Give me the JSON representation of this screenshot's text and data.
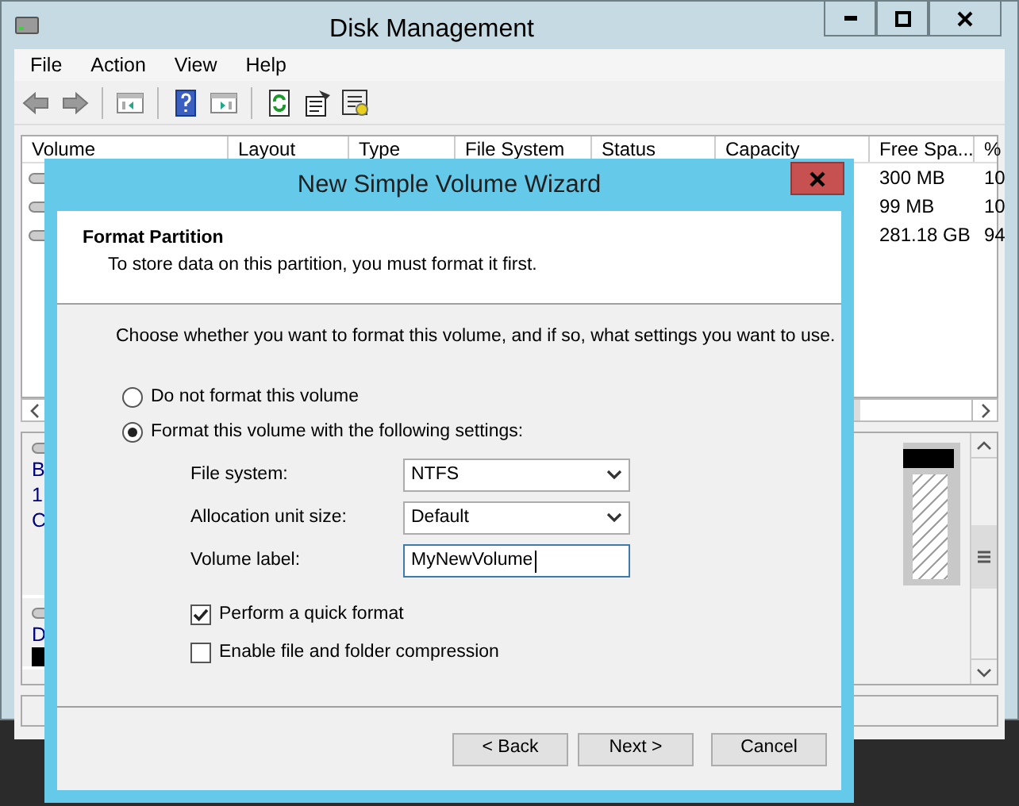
{
  "window": {
    "title": "Disk Management"
  },
  "menu": [
    "File",
    "Action",
    "View",
    "Help"
  ],
  "table": {
    "columns": [
      "Volume",
      "Layout",
      "Type",
      "File System",
      "Status",
      "Capacity",
      "Free Spa...",
      "%"
    ],
    "rows": [
      {
        "free_space": "300 MB",
        "column_8": "10"
      },
      {
        "free_space": "99 MB",
        "column_8": "10"
      },
      {
        "free_space": "281.18 GB",
        "column_8": "94"
      }
    ]
  },
  "disks": [
    {
      "lines": [
        "B",
        "1",
        "C"
      ]
    },
    {
      "lines": [
        "D"
      ]
    }
  ],
  "wizard": {
    "title": "New Simple Volume Wizard",
    "header": {
      "title": "Format Partition",
      "subtitle": "To store data on this partition, you must format it first."
    },
    "instructions": "Choose whether you want to format this volume, and if so, what settings you want to use.",
    "options": [
      {
        "label": "Do not format this volume",
        "selected": false
      },
      {
        "label": "Format this volume with the following settings:",
        "selected": true
      }
    ],
    "fields": [
      {
        "label": "File system:",
        "kind": "select",
        "value": "NTFS"
      },
      {
        "label": "Allocation unit size:",
        "kind": "select",
        "value": "Default"
      },
      {
        "label": "Volume label:",
        "kind": "text",
        "value": "MyNewVolume"
      }
    ],
    "checkboxes": [
      {
        "label": "Perform a quick format",
        "checked": true
      },
      {
        "label": "Enable file and folder compression",
        "checked": false
      }
    ],
    "buttons": [
      "< Back",
      "Next >",
      "Cancel"
    ]
  }
}
